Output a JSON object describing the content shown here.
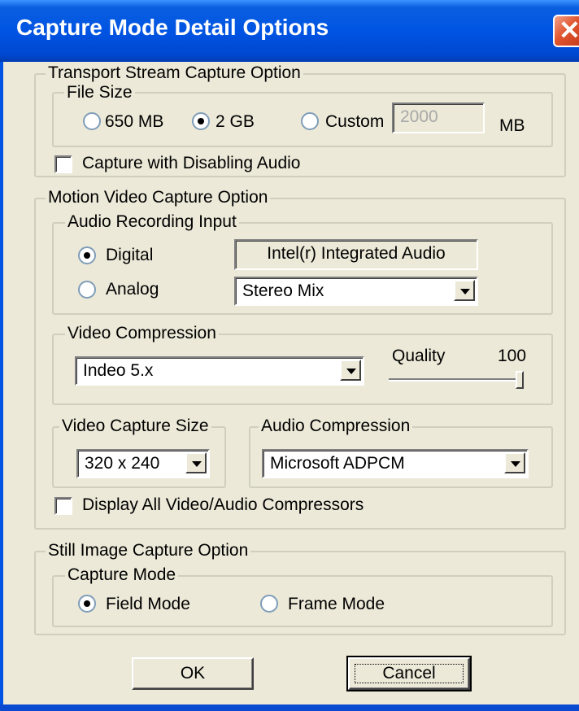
{
  "window": {
    "title": "Capture Mode Detail Options"
  },
  "transport_stream": {
    "title": "Transport Stream Capture Option",
    "file_size": {
      "title": "File Size",
      "options": [
        {
          "label": "650 MB",
          "selected": false
        },
        {
          "label": "2 GB",
          "selected": true
        },
        {
          "label": "Custom",
          "selected": false
        }
      ],
      "custom_value": "2000",
      "unit": "MB"
    },
    "disable_audio": {
      "label": "Capture with Disabling Audio",
      "checked": false
    }
  },
  "motion_video": {
    "title": "Motion Video Capture Option",
    "audio_input": {
      "title": "Audio Recording Input",
      "options": [
        {
          "label": "Digital",
          "selected": true
        },
        {
          "label": "Analog",
          "selected": false
        }
      ],
      "device": "Intel(r) Integrated Audio",
      "source": "Stereo Mix"
    },
    "video_compression": {
      "title": "Video Compression",
      "codec": "Indeo 5.x",
      "quality_label": "Quality",
      "quality_value": "100",
      "quality_level": 1.0
    },
    "video_capture_size": {
      "title": "Video Capture Size",
      "value": "320 x 240"
    },
    "audio_compression": {
      "title": "Audio Compression",
      "value": "Microsoft ADPCM"
    },
    "display_all": {
      "label": "Display All Video/Audio Compressors",
      "checked": false
    }
  },
  "still_image": {
    "title": "Still Image Capture Option",
    "capture_mode": {
      "title": "Capture Mode",
      "options": [
        {
          "label": "Field Mode",
          "selected": true
        },
        {
          "label": "Frame Mode",
          "selected": false
        }
      ]
    }
  },
  "buttons": {
    "ok": "OK",
    "cancel": "Cancel"
  },
  "colors": {
    "title_bar": "#0054e3",
    "dialog_bg": "#ece9d8",
    "close_button": "#e0542e"
  }
}
